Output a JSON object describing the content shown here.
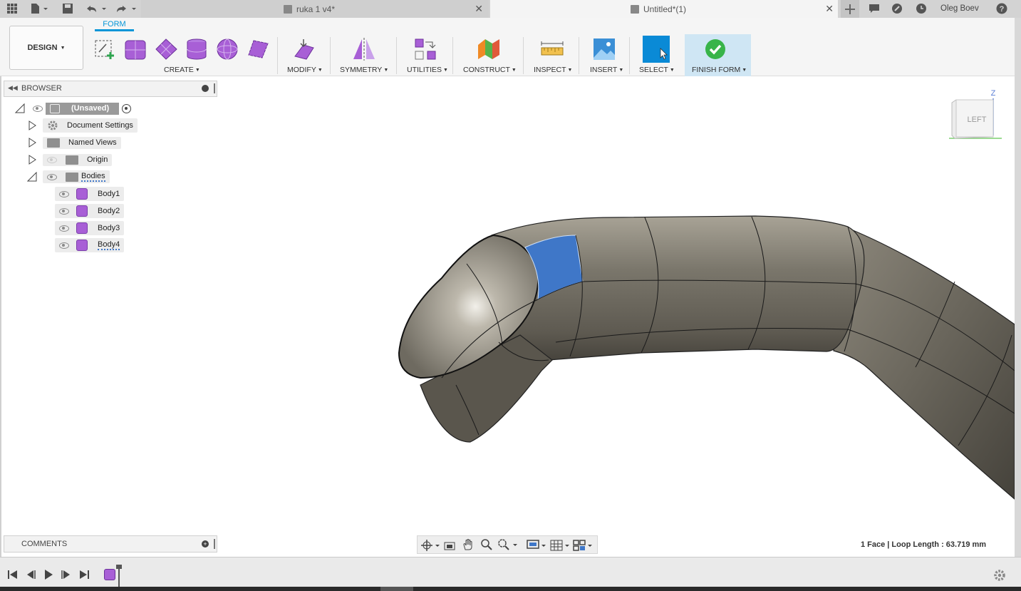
{
  "window": {
    "tabs": [
      {
        "title": "ruka 1 v4*"
      },
      {
        "title": "Untitled*(1)"
      }
    ],
    "user_name": "Oleg Boev"
  },
  "toolbar": {
    "workspace_label": "DESIGN",
    "active_tab": "FORM",
    "groups": {
      "create": "CREATE",
      "modify": "MODIFY",
      "symmetry": "SYMMETRY",
      "utilities": "UTILITIES",
      "construct": "CONSTRUCT",
      "inspect": "INSPECT",
      "insert": "INSERT",
      "select": "SELECT",
      "finish_form": "FINISH FORM"
    },
    "accent_color": "#0696d7",
    "form_icon_color": "#a85fd6"
  },
  "browser": {
    "title": "BROWSER",
    "root": "(Unsaved)",
    "items": [
      {
        "label": "Document Settings",
        "icon": "gear-icon"
      },
      {
        "label": "Named Views",
        "icon": "folder-icon"
      },
      {
        "label": "Origin",
        "icon": "folder-icon"
      },
      {
        "label": "Bodies",
        "icon": "folder-icon"
      }
    ],
    "bodies": [
      "Body1",
      "Body2",
      "Body3",
      "Body4"
    ]
  },
  "viewcube": {
    "face": "LEFT",
    "axis_z": "Z"
  },
  "comments": {
    "title": "COMMENTS"
  },
  "status": {
    "selection_info": "1 Face | Loop Length : 63.719 mm"
  },
  "model": {
    "surface_color": "#6e6a60",
    "selected_face_color": "#3f77c8"
  }
}
